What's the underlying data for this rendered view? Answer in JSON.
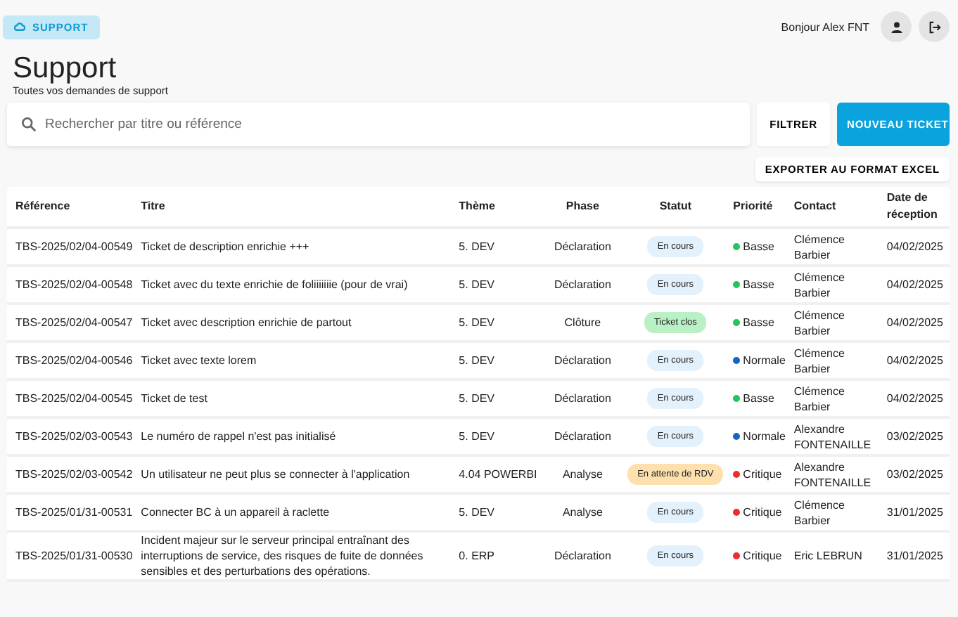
{
  "header": {
    "app_button": "SUPPORT",
    "greeting": "Bonjour Alex FNT"
  },
  "page": {
    "title": "Support",
    "subtitle": "Toutes vos demandes de support"
  },
  "search": {
    "placeholder": "Rechercher par titre ou référence"
  },
  "buttons": {
    "filter": "FILTRER",
    "new_ticket": "NOUVEAU TICKET",
    "export": "EXPORTER AU FORMAT EXCEL"
  },
  "table": {
    "columns": [
      "Référence",
      "Titre",
      "Thème",
      "Phase",
      "Statut",
      "Priorité",
      "Contact",
      "Date de réception"
    ],
    "rows": [
      {
        "reference": "TBS-2025/02/04-00549",
        "title": "Ticket de description enrichie +++",
        "theme": "5. DEV",
        "phase": "Déclaration",
        "status": {
          "label": "En cours",
          "kind": "progress"
        },
        "priority": {
          "label": "Basse",
          "color": "#22c55e"
        },
        "contact": "Clémence Barbier",
        "date": "04/02/2025"
      },
      {
        "reference": "TBS-2025/02/04-00548",
        "title": "Ticket avec du texte enrichie de foliiiiiiie (pour de vrai)",
        "theme": "5. DEV",
        "phase": "Déclaration",
        "status": {
          "label": "En cours",
          "kind": "progress"
        },
        "priority": {
          "label": "Basse",
          "color": "#22c55e"
        },
        "contact": "Clémence Barbier",
        "date": "04/02/2025"
      },
      {
        "reference": "TBS-2025/02/04-00547",
        "title": "Ticket avec description enrichie de partout",
        "theme": "5. DEV",
        "phase": "Clôture",
        "status": {
          "label": "Ticket clos",
          "kind": "closed"
        },
        "priority": {
          "label": "Basse",
          "color": "#22c55e"
        },
        "contact": "Clémence Barbier",
        "date": "04/02/2025"
      },
      {
        "reference": "TBS-2025/02/04-00546",
        "title": "Ticket avec texte lorem",
        "theme": "5. DEV",
        "phase": "Déclaration",
        "status": {
          "label": "En cours",
          "kind": "progress"
        },
        "priority": {
          "label": "Normale",
          "color": "#1565c0"
        },
        "contact": "Clémence Barbier",
        "date": "04/02/2025"
      },
      {
        "reference": "TBS-2025/02/04-00545",
        "title": "Ticket de test",
        "theme": "5. DEV",
        "phase": "Déclaration",
        "status": {
          "label": "En cours",
          "kind": "progress"
        },
        "priority": {
          "label": "Basse",
          "color": "#22c55e"
        },
        "contact": "Clémence Barbier",
        "date": "04/02/2025"
      },
      {
        "reference": "TBS-2025/02/03-00543",
        "title": "Le numéro de rappel n'est pas initialisé",
        "theme": "5. DEV",
        "phase": "Déclaration",
        "status": {
          "label": "En cours",
          "kind": "progress"
        },
        "priority": {
          "label": "Normale",
          "color": "#1565c0"
        },
        "contact": "Alexandre FONTENAILLE",
        "date": "03/02/2025"
      },
      {
        "reference": "TBS-2025/02/03-00542",
        "title": "Un utilisateur ne peut plus se connecter à l'application",
        "theme": "4.04 POWERBI",
        "phase": "Analyse",
        "status": {
          "label": "En attente de RDV",
          "kind": "waiting"
        },
        "priority": {
          "label": "Critique",
          "color": "#ef2b2b"
        },
        "contact": "Alexandre FONTENAILLE",
        "date": "03/02/2025"
      },
      {
        "reference": "TBS-2025/01/31-00531",
        "title": "Connecter BC à un appareil à raclette",
        "theme": "5. DEV",
        "phase": "Analyse",
        "status": {
          "label": "En cours",
          "kind": "progress"
        },
        "priority": {
          "label": "Critique",
          "color": "#ef2b2b"
        },
        "contact": "Clémence Barbier",
        "date": "31/01/2025"
      },
      {
        "reference": "TBS-2025/01/31-00530",
        "title": "Incident majeur sur le serveur principal entraînant des interruptions de service, des risques de fuite de données sensibles et des perturbations des opérations.",
        "theme": "0. ERP",
        "phase": "Déclaration",
        "status": {
          "label": "En cours",
          "kind": "progress"
        },
        "priority": {
          "label": "Critique",
          "color": "#ef2b2b"
        },
        "contact": "Eric LEBRUN",
        "date": "31/01/2025"
      }
    ]
  }
}
